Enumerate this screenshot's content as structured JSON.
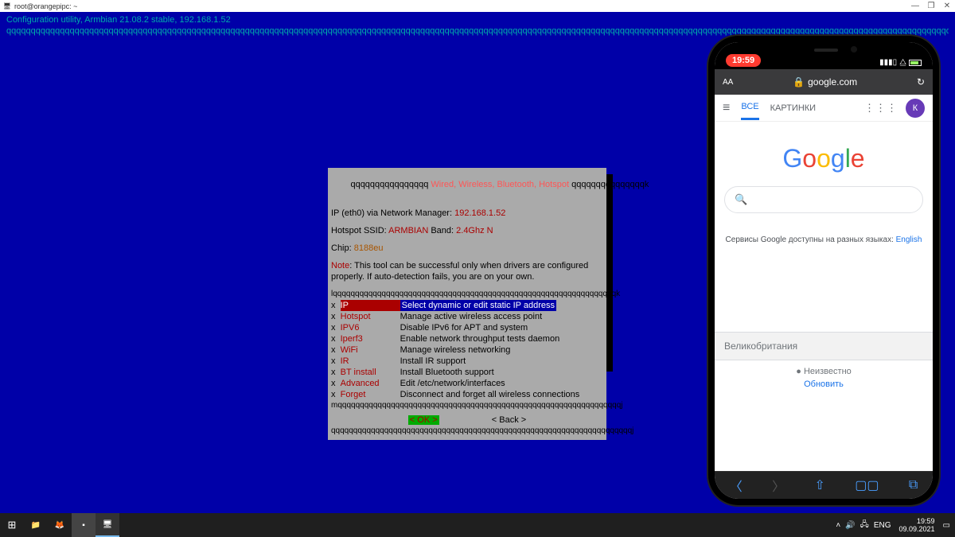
{
  "window": {
    "title": "root@orangepipc: ~"
  },
  "terminal": {
    "header": "Configuration utility, Armbian 21.08.2 stable, 192.168.1.52",
    "border_line": "qqqqqqqqqqqqqqqqqqqqqqqqqqqqqqqqqqqqqqqqqqqqqqqqqqqqqqqqqqqqqqqqqqqqqqqqqqqqqqqqqqqqqqqqqqqqqqqqqqqqqqqqqqqqqqqqqqqqqqqqqqqqqqqqqqqqqqqqqqqqqqqqqqqqqqqqqqqqqqqqqqqqqqqqqqqqqqqqqqqqqqqqqqqqqqqqqqqqqqqqqqqqqqqqqqqqqqqqqqqqqqqqqqqqqqqq"
  },
  "dialog": {
    "title_border_l": "qqqqqqqqqqqqqqqq ",
    "title": "Wired, Wireless, Bluetooth, Hotspot",
    "title_border_r": " qqqqqqqqqqqqqqqk",
    "ip_label": "IP (eth0) via Network Manager: ",
    "ip_value": "192.168.1.52",
    "hotspot_label": "Hotspot SSID: ",
    "hotspot_ssid": "ARMBIAN",
    "band_label": " Band: ",
    "band_value": "2.4Ghz N",
    "chip_label": "Chip: ",
    "chip_value": "8188eu",
    "note_label": "Note",
    "note_text": ": This tool can be successful only when drivers are configured",
    "note_text2": "properly. If auto-detection fails, you are on your own.",
    "menu_top": "lqqqqqqqqqqqqqqqqqqqqqqqqqqqqqqqqqqqqqqqqqqqqqqqqqqqqqqqqqqqqqqqqk",
    "items": [
      {
        "label": "IP",
        "desc": "Select dynamic or edit static IP address",
        "sel": true
      },
      {
        "label": "Hotspot",
        "desc": "Manage active wireless access point"
      },
      {
        "label": "IPV6",
        "desc": "Disable IPv6 for APT and system"
      },
      {
        "label": "Iperf3",
        "desc": "Enable network throughput tests daemon"
      },
      {
        "label": "WiFi",
        "desc": "Manage wireless networking"
      },
      {
        "label": "IR",
        "desc": "Install IR support"
      },
      {
        "label": "BT install",
        "desc": "Install Bluetooth support"
      },
      {
        "label": "Advanced",
        "desc": "Edit /etc/network/interfaces"
      },
      {
        "label": "Forget",
        "desc": "Disconnect and forget all wireless connections"
      }
    ],
    "menu_bot": "mqqqqqqqqqqqqqqqqqqqqqqqqqqqqqqqqqqqqqqqqqqqqqqqqqqqqqqqqqqqqqqqqj",
    "ok": "<  OK  >",
    "back": "< Back >",
    "bottom_border": "qqqqqqqqqqqqqqqqqqqqqqqqqqqqqqqqqqqqqqqqqqqqqqqqqqqqqqqqqqqqqqqqqqqqj"
  },
  "phone": {
    "time": "19:59",
    "url_prefix": "AA",
    "url": "google.com",
    "tabs": {
      "all": "ВСЕ",
      "images": "КАРТИНКИ"
    },
    "avatar": "К",
    "services_text": "Сервисы Google доступны на разных языках:  ",
    "services_link": "English",
    "country": "Великобритания",
    "unknown": "Неизвестно",
    "update": "Обновить"
  },
  "taskbar": {
    "tray": {
      "lang": "ENG",
      "time": "19:59",
      "date": "09.09.2021"
    }
  }
}
